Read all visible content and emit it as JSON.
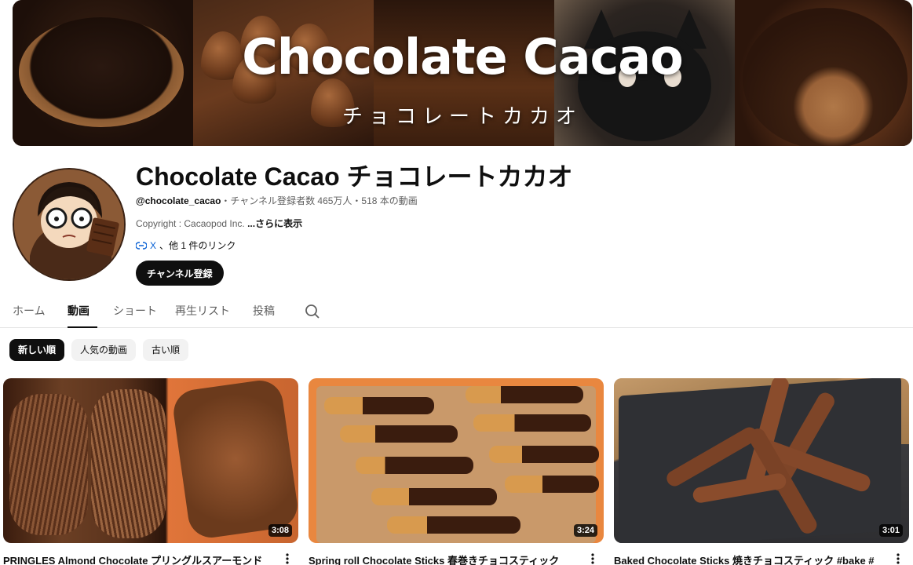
{
  "banner": {
    "title": "Chocolate Cacao",
    "subtitle": "チョコレートカカオ"
  },
  "channel": {
    "name": "Chocolate Cacao チョコレートカカオ",
    "handle": "@chocolate_cacao",
    "stats": "・チャンネル登録者数 465万人・518 本の動画",
    "description": "Copyright : Cacaopod Inc. ",
    "more": "...さらに表示",
    "link_x": "X",
    "link_more": "、他 1 件のリンク",
    "subscribe_label": "チャンネル登録"
  },
  "tabs": [
    {
      "label": "ホーム"
    },
    {
      "label": "動画"
    },
    {
      "label": "ショート"
    },
    {
      "label": "再生リスト"
    },
    {
      "label": "投稿"
    }
  ],
  "active_tab": "動画",
  "chips": [
    {
      "label": "新しい順"
    },
    {
      "label": "人気の動画"
    },
    {
      "label": "古い順"
    }
  ],
  "active_chip": "新しい順",
  "videos": [
    {
      "title": "PRINGLES Almond Chocolate プリングルスアーモンド",
      "duration": "3:08"
    },
    {
      "title": "Spring roll Chocolate Sticks 春巻きチョコスティック",
      "duration": "3:24"
    },
    {
      "title": "Baked Chocolate Sticks 焼きチョコスティック #bake #",
      "duration": "3:01"
    }
  ],
  "icons": {
    "search": "search-icon",
    "link": "link-icon",
    "more": "more-vert-icon"
  },
  "colors": {
    "primary_text": "#0f0f0f",
    "secondary_text": "#606060",
    "link": "#065fd4",
    "chip_bg": "#f2f2f2"
  }
}
